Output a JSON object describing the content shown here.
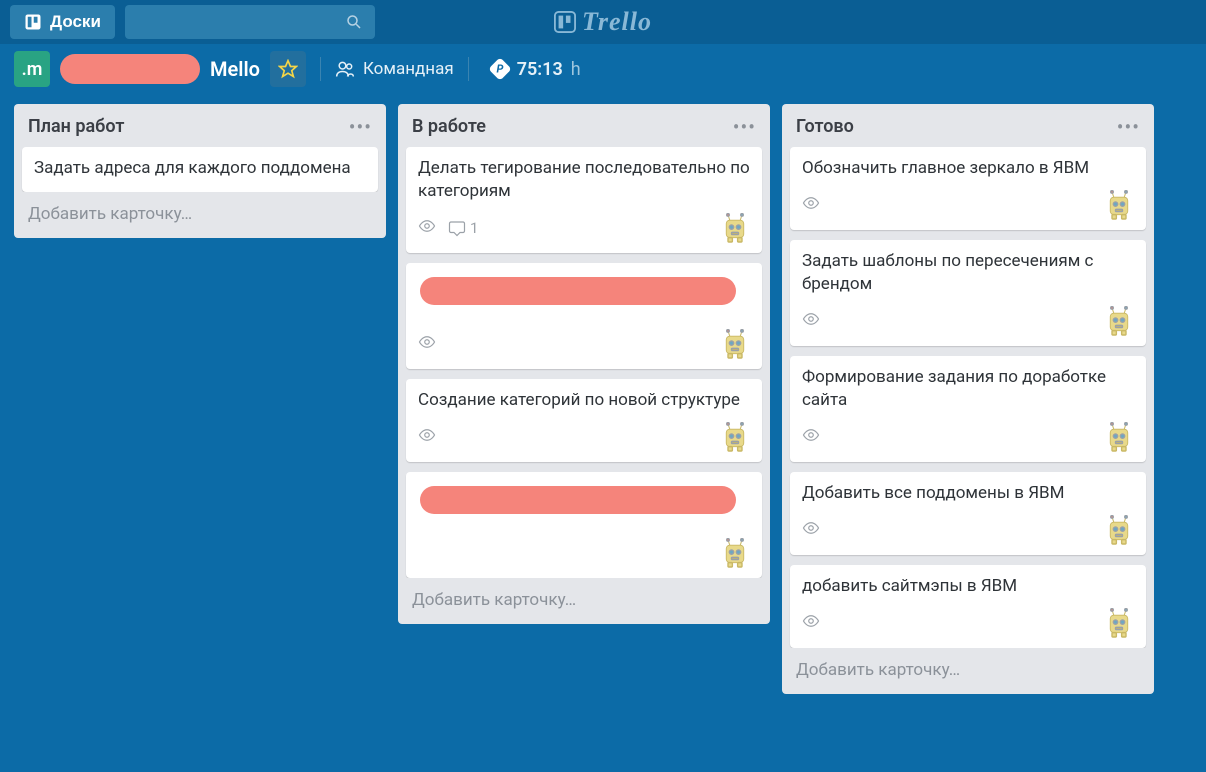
{
  "header": {
    "boards_label": "Доски",
    "brand": "Trello"
  },
  "board": {
    "org_initial": ".m",
    "title": "Mello",
    "visibility": "Командная",
    "time_value": "75:13",
    "time_unit": "h"
  },
  "lists": [
    {
      "title": "План работ",
      "add_card": "Добавить карточку…",
      "cards": [
        {
          "title": "Задать адреса для каждого поддомена",
          "watch": false,
          "comments": null,
          "avatar": false,
          "redacted": false
        }
      ]
    },
    {
      "title": "В работе",
      "add_card": "Добавить карточку…",
      "cards": [
        {
          "title": "Делать тегирование последовательно по категориям",
          "watch": true,
          "comments": 1,
          "avatar": true,
          "redacted": false
        },
        {
          "title": "████████████████████",
          "watch": true,
          "comments": null,
          "avatar": true,
          "redacted": true
        },
        {
          "title": "Создание категорий по новой структуре",
          "watch": true,
          "comments": null,
          "avatar": true,
          "redacted": false
        },
        {
          "title": "████████████████████",
          "watch": false,
          "comments": null,
          "avatar": true,
          "redacted": true
        }
      ]
    },
    {
      "title": "Готово",
      "add_card": "Добавить карточку…",
      "cards": [
        {
          "title": "Обозначить главное зеркало в ЯВМ",
          "watch": true,
          "comments": null,
          "avatar": true,
          "redacted": false
        },
        {
          "title": "Задать шаблоны по пересечениям с брендом",
          "watch": true,
          "comments": null,
          "avatar": true,
          "redacted": false
        },
        {
          "title": "Формирование задания по доработке сайта",
          "watch": true,
          "comments": null,
          "avatar": true,
          "redacted": false
        },
        {
          "title": "Добавить все поддомены в ЯВМ",
          "watch": true,
          "comments": null,
          "avatar": true,
          "redacted": false
        },
        {
          "title": "добавить сайтмэпы в ЯВМ",
          "watch": true,
          "comments": null,
          "avatar": true,
          "redacted": false
        }
      ]
    }
  ]
}
